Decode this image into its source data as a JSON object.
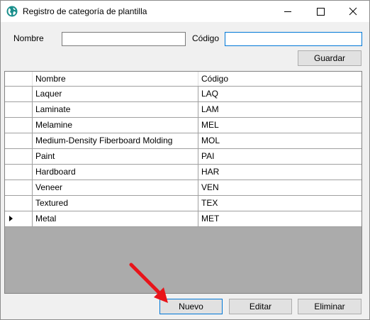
{
  "window": {
    "title": "Registro de categoría de plantilla",
    "icon": "globe-app-icon",
    "controls": [
      "minimize-icon",
      "maximize-icon",
      "close-icon"
    ]
  },
  "form": {
    "nombre_label": "Nombre",
    "nombre_value": "",
    "codigo_label": "Código",
    "codigo_value": "",
    "guardar_label": "Guardar"
  },
  "grid": {
    "columns": [
      "Nombre",
      "Código"
    ],
    "current_row": 8,
    "rows": [
      {
        "nombre": "Laquer",
        "codigo": "LAQ"
      },
      {
        "nombre": "Laminate",
        "codigo": "LAM"
      },
      {
        "nombre": "Melamine",
        "codigo": "MEL"
      },
      {
        "nombre": "Medium-Density Fiberboard Molding",
        "codigo": "MOL"
      },
      {
        "nombre": "Paint",
        "codigo": "PAI"
      },
      {
        "nombre": "Hardboard",
        "codigo": "HAR"
      },
      {
        "nombre": "Veneer",
        "codigo": "VEN"
      },
      {
        "nombre": "Textured",
        "codigo": "TEX"
      },
      {
        "nombre": "Metal",
        "codigo": "MET"
      }
    ]
  },
  "actions": {
    "nuevo_label": "Nuevo",
    "editar_label": "Editar",
    "eliminar_label": "Eliminar"
  },
  "colors": {
    "focus_border": "#0078d7",
    "grid_background": "#ababab",
    "annotation_arrow": "#e8141a"
  }
}
